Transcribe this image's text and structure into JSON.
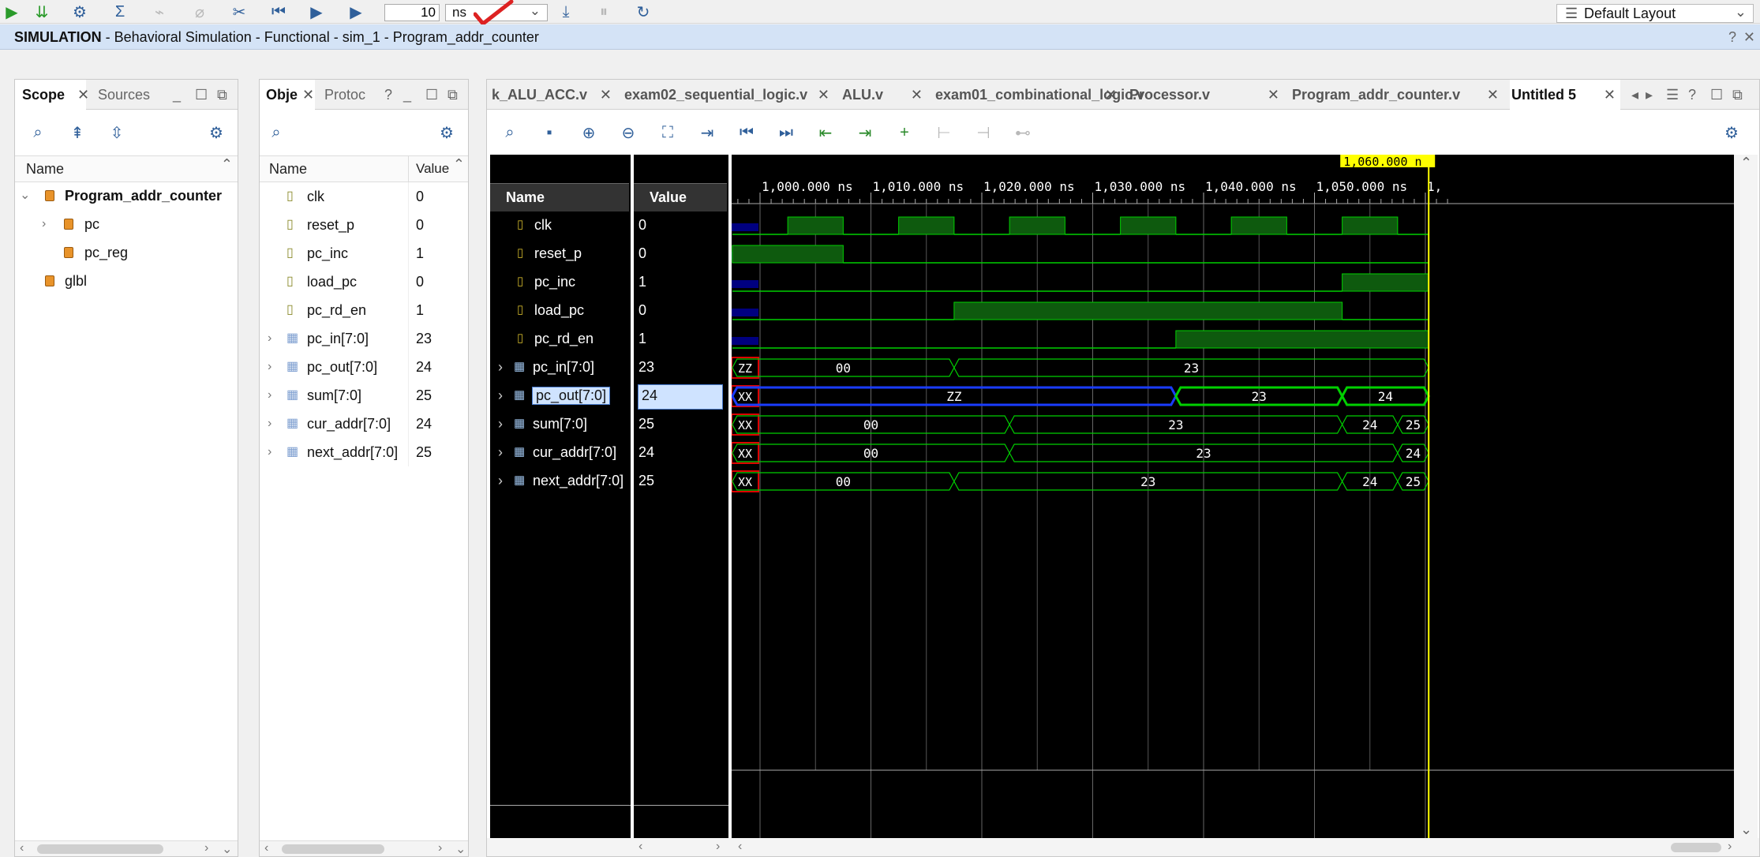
{
  "toolbar": {
    "time_value": "10",
    "time_unit": "ns",
    "layout": "Default Layout",
    "icons": [
      "run-green-icon",
      "step-icon",
      "gear-icon",
      "sigma-icon",
      "wand-icon",
      "wand-disabled-icon",
      "pin-icon",
      "restart-icon",
      "run-all-icon",
      "run-for-icon",
      "step-down-icon",
      "pause-icon",
      "relaunch-icon"
    ]
  },
  "sim_header": {
    "bold": "SIMULATION",
    "rest": " - Behavioral Simulation - Functional - sim_1 - Program_addr_counter",
    "help": "?",
    "close": "✕"
  },
  "scope": {
    "tabs": [
      "Scope",
      "Sources"
    ],
    "col": "Name",
    "rows": [
      {
        "label": "Program_addr_counter",
        "bold": true
      },
      {
        "label": "pc"
      },
      {
        "label": "pc_reg"
      },
      {
        "label": "glbl"
      }
    ]
  },
  "objects": {
    "tabs": [
      "Obje",
      "Protoc",
      "?"
    ],
    "col_name": "Name",
    "col_value": "Value",
    "rows": [
      {
        "name": "clk",
        "value": "0"
      },
      {
        "name": "reset_p",
        "value": "0"
      },
      {
        "name": "pc_inc",
        "value": "1"
      },
      {
        "name": "load_pc",
        "value": "0"
      },
      {
        "name": "pc_rd_en",
        "value": "1"
      },
      {
        "name": "pc_in[7:0]",
        "value": "23"
      },
      {
        "name": "pc_out[7:0]",
        "value": "24"
      },
      {
        "name": "sum[7:0]",
        "value": "25"
      },
      {
        "name": "cur_addr[7:0]",
        "value": "24"
      },
      {
        "name": "next_addr[7:0]",
        "value": "25"
      }
    ]
  },
  "editor_tabs": [
    "k_ALU_ACC.v",
    "exam02_sequential_logic.v",
    "ALU.v",
    "exam01_combinational_logic.v",
    "Processor.v",
    "Program_addr_counter.v",
    "Untitled 5"
  ],
  "wave": {
    "col_name": "Name",
    "col_value": "Value",
    "cursor_label": "1,060.000 n",
    "ticks": [
      "1,000.000 ns",
      "1,010.000 ns",
      "1,020.000 ns",
      "1,030.000 ns",
      "1,040.000 ns",
      "1,050.000 ns",
      "1,"
    ],
    "signals": [
      {
        "name": "clk",
        "value": "0"
      },
      {
        "name": "reset_p",
        "value": "0"
      },
      {
        "name": "pc_inc",
        "value": "1"
      },
      {
        "name": "load_pc",
        "value": "0"
      },
      {
        "name": "pc_rd_en",
        "value": "1"
      },
      {
        "name": "pc_in[7:0]",
        "value": "23",
        "pre": "ZZ",
        "segs": [
          "00",
          "23"
        ]
      },
      {
        "name": "pc_out[7:0]",
        "value": "24",
        "pre": "XX",
        "segs": [
          "ZZ",
          "23",
          "24"
        ]
      },
      {
        "name": "sum[7:0]",
        "value": "25",
        "pre": "XX",
        "segs": [
          "00",
          "23",
          "24",
          "25"
        ]
      },
      {
        "name": "cur_addr[7:0]",
        "value": "24",
        "pre": "XX",
        "segs": [
          "00",
          "23",
          "24"
        ]
      },
      {
        "name": "next_addr[7:0]",
        "value": "25",
        "pre": "XX",
        "segs": [
          "00",
          "23",
          "24",
          "25"
        ]
      }
    ]
  },
  "colors": {
    "accent": "#2f5f9a",
    "wave_green": "#00d000",
    "wave_fill": "#0e5a0e",
    "cursor": "#ffff00",
    "selected": "#cfe3ff"
  }
}
